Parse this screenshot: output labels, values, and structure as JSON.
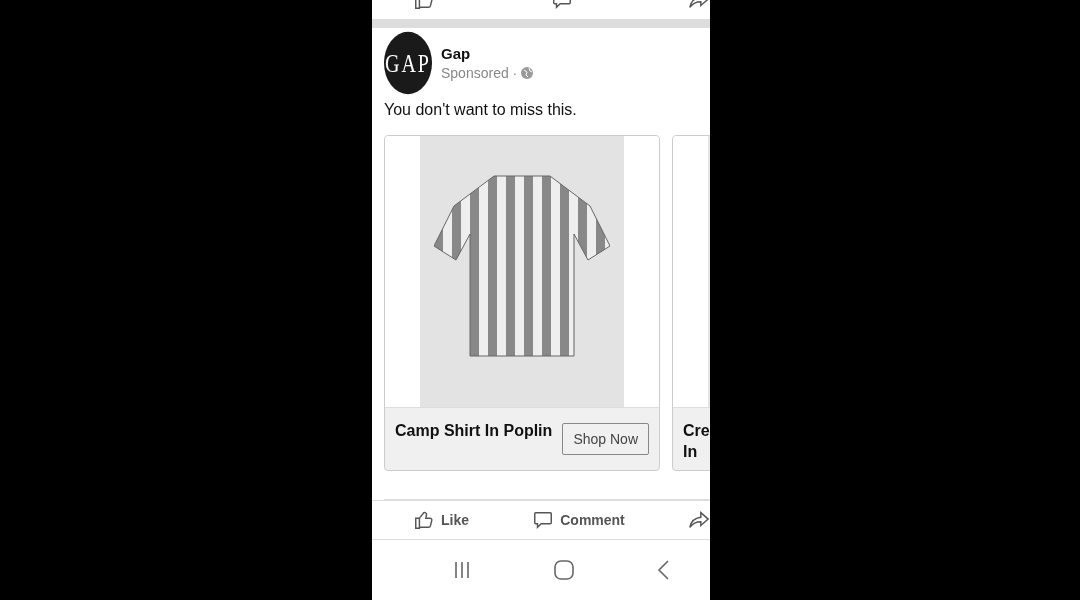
{
  "previous_post_actions": [
    {
      "kind": "like"
    },
    {
      "kind": "comment"
    },
    {
      "kind": "share"
    }
  ],
  "post": {
    "page_name": "Gap",
    "logo_text": "GAP",
    "meta": "Sponsored ·",
    "message": "You don't want to miss this.",
    "cards": [
      {
        "title_lines": [
          "Camp Shirt In Poplin"
        ],
        "button": "Shop Now"
      },
      {
        "title_lines": [
          "Cre",
          "In"
        ]
      }
    ],
    "actions": [
      {
        "kind": "like",
        "label": "Like"
      },
      {
        "kind": "comment",
        "label": "Comment"
      },
      {
        "kind": "share"
      }
    ]
  }
}
